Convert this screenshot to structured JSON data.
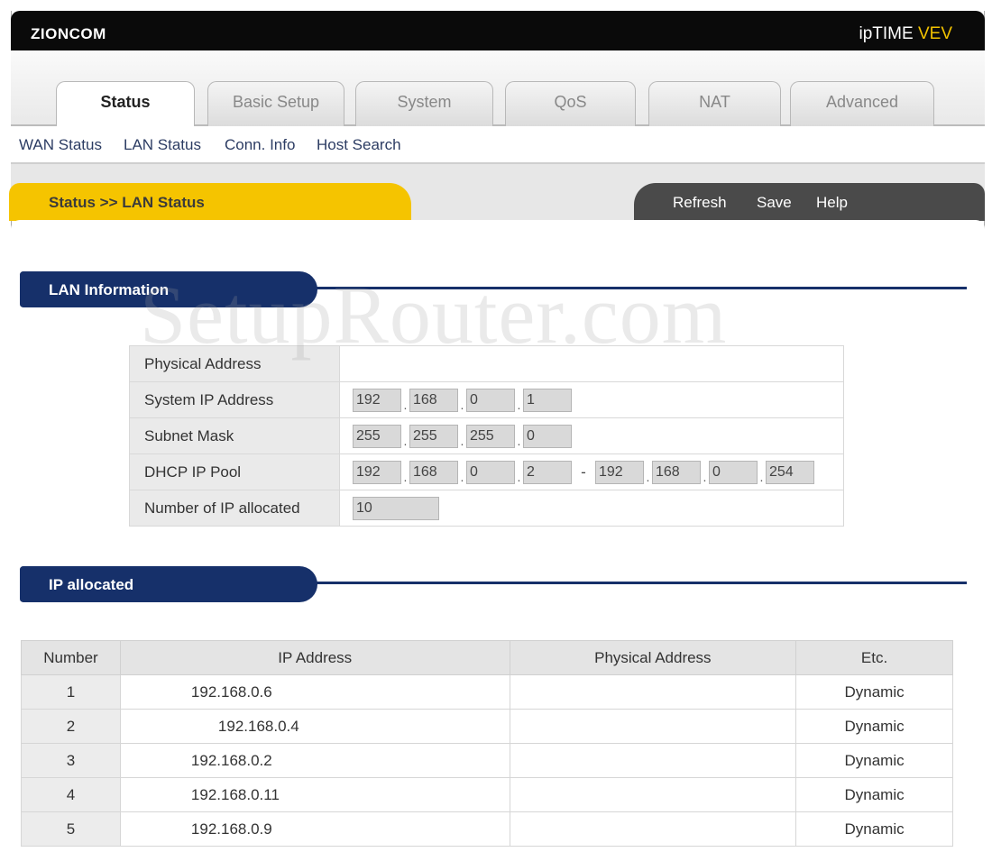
{
  "header": {
    "brand": "ZIONCOM",
    "product_a": "ipTIME",
    "product_b": "VEV"
  },
  "tabs": [
    {
      "label": "Status",
      "active": true
    },
    {
      "label": "Basic Setup",
      "active": false
    },
    {
      "label": "System",
      "active": false
    },
    {
      "label": "QoS",
      "active": false
    },
    {
      "label": "NAT",
      "active": false
    },
    {
      "label": "Advanced",
      "active": false
    }
  ],
  "subnav": [
    "WAN Status",
    "LAN Status",
    "Conn. Info",
    "Host Search"
  ],
  "breadcrumb": "Status >> LAN Status",
  "actions": {
    "refresh": "Refresh",
    "save": "Save",
    "help": "Help"
  },
  "watermark": "SetupRouter.com",
  "lan_info": {
    "title": "LAN Information",
    "physical_address_label": "Physical Address",
    "physical_address": "",
    "system_ip_label": "System IP Address",
    "system_ip": [
      "192",
      "168",
      "0",
      "1"
    ],
    "subnet_label": "Subnet Mask",
    "subnet": [
      "255",
      "255",
      "255",
      "0"
    ],
    "dhcp_label": "DHCP IP Pool",
    "dhcp_start": [
      "192",
      "168",
      "0",
      "2"
    ],
    "dhcp_sep": "-",
    "dhcp_end": [
      "192",
      "168",
      "0",
      "254"
    ],
    "allocated_label": "Number of IP allocated",
    "allocated": "10"
  },
  "ip_allocated": {
    "title": "IP allocated",
    "columns": [
      "Number",
      "IP Address",
      "Physical Address",
      "Etc."
    ],
    "rows": [
      {
        "num": "1",
        "ip": "192.168.0.6",
        "mac": "",
        "etc": "Dynamic"
      },
      {
        "num": "2",
        "ip": "192.168.0.4",
        "mac": "",
        "etc": "Dynamic"
      },
      {
        "num": "3",
        "ip": "192.168.0.2",
        "mac": "",
        "etc": "Dynamic"
      },
      {
        "num": "4",
        "ip": "192.168.0.11",
        "mac": "",
        "etc": "Dynamic"
      },
      {
        "num": "5",
        "ip": "192.168.0.9",
        "mac": "",
        "etc": "Dynamic"
      }
    ]
  },
  "colors": {
    "header_bg": "#0a0a0a",
    "accent_yellow": "#f5c400",
    "section_blue": "#16306a",
    "link": "#2c3c63"
  }
}
